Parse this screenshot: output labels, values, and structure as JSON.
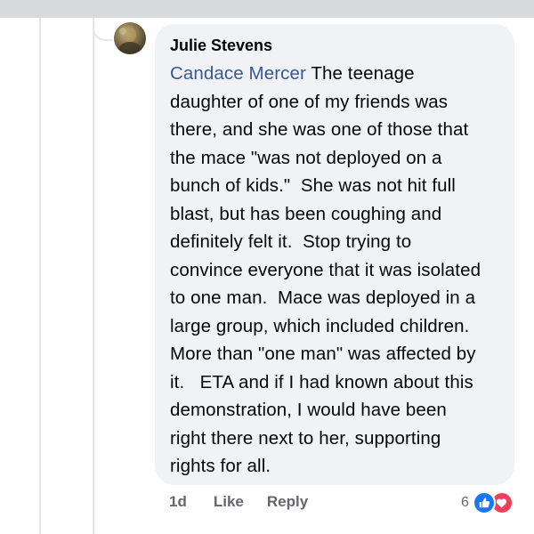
{
  "comment": {
    "author": "Julie Stevens",
    "mention": "Candace Mercer",
    "text_lines": [
      " The teenage",
      "daughter of one of my friends was",
      "there, and she was one of those that",
      "the mace \"was not deployed on a",
      "bunch of kids.\"  She was not hit full",
      "blast, but has been coughing and",
      "definitely felt it.  Stop trying to",
      "convince everyone that it was isolated",
      "to one man.  Mace was deployed in a",
      "large group, which included children.",
      "More than \"one man\" was affected by",
      "it.   ETA and if I had known about this",
      "demonstration, I would have been",
      "right there next to her, supporting",
      "rights for all."
    ]
  },
  "actions": {
    "time": "1d",
    "like": "Like",
    "reply": "Reply"
  },
  "reactions": {
    "count": "6",
    "types": [
      "like-icon",
      "love-icon"
    ]
  },
  "colors": {
    "mention": "#385898",
    "bubble": "#f0f2f5",
    "like": "#1877f2",
    "love": "#f33e58",
    "meta": "#65676b"
  }
}
